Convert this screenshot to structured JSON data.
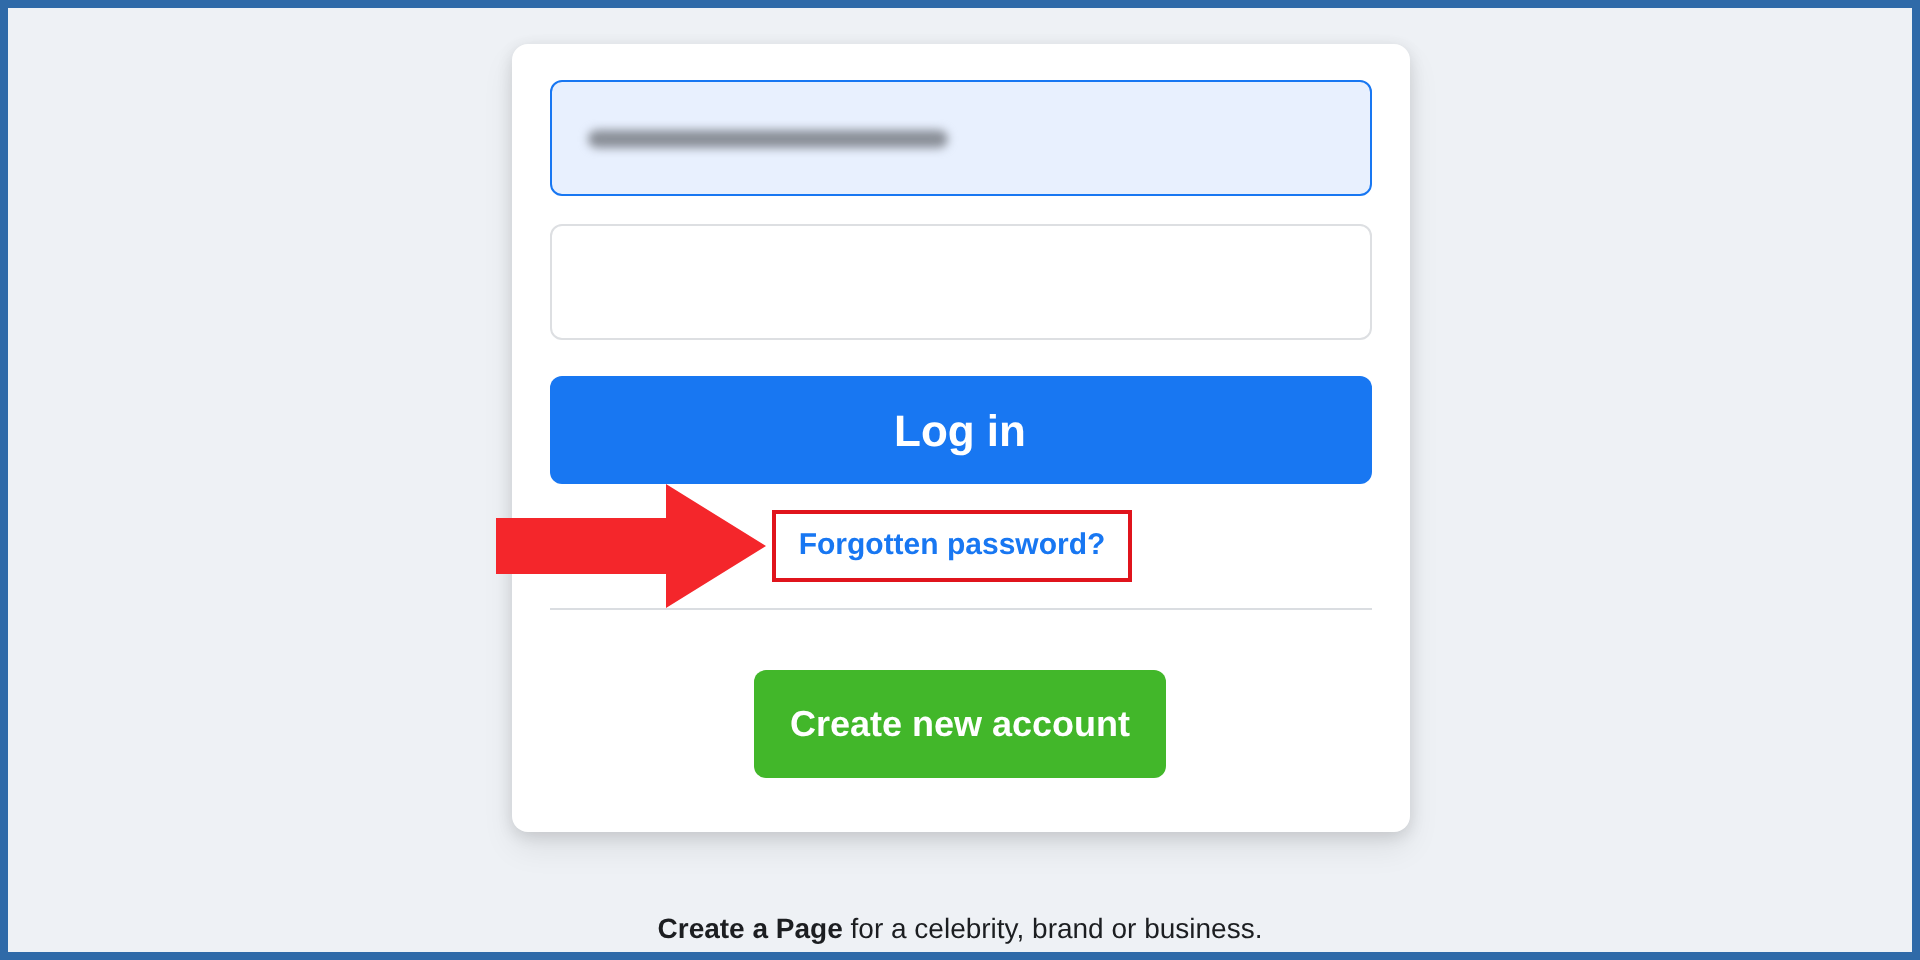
{
  "login_card": {
    "fields": [
      {
        "focused": true,
        "value_hidden": true
      },
      {
        "focused": false,
        "value_hidden": false
      }
    ],
    "login_button": "Log in",
    "forgot_link": "Forgotten password?",
    "annotation": {
      "kind": "arrow-and-box"
    },
    "create_button": "Create new account"
  },
  "footer": "**Create a Page** for a celebrity, brand or business."
}
